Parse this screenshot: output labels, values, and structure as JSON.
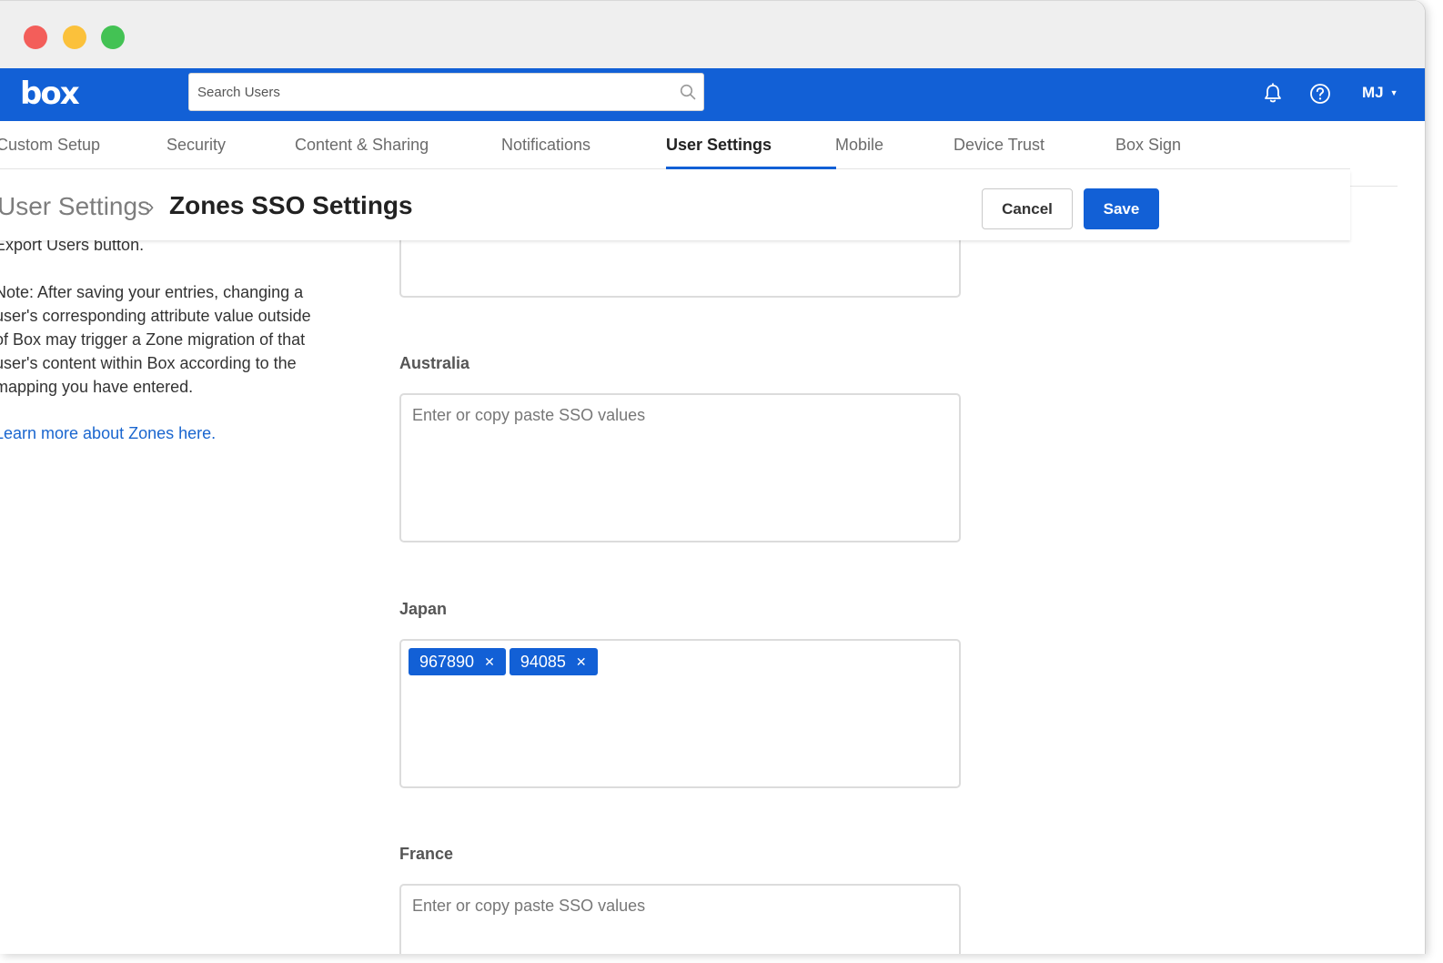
{
  "app": {
    "logo_text": "box",
    "search": {
      "placeholder": "Search Users",
      "value": ""
    },
    "user_initials": "MJ",
    "accent_color": "#1260d6"
  },
  "tabs": [
    {
      "label": "Custom Setup"
    },
    {
      "label": "Security"
    },
    {
      "label": "Content & Sharing"
    },
    {
      "label": "Notifications"
    },
    {
      "label": "User Settings",
      "active": true
    },
    {
      "label": "Mobile"
    },
    {
      "label": "Device Trust"
    },
    {
      "label": "Box Sign"
    }
  ],
  "header": {
    "breadcrumb_parent": "User Settings",
    "breadcrumb_separator": "›",
    "title": "Zones SSO Settings",
    "cancel_label": "Cancel",
    "save_label": "Save"
  },
  "sidebar": {
    "lines_top": [
      "Export Users button."
    ],
    "note_lines": [
      "Note: After saving your entries, changing a",
      "user's corresponding attribute value outside",
      "of Box may trigger a Zone migration of that",
      "user's content within Box according to the",
      "mapping you have entered."
    ],
    "learn_more": "Learn more about Zones here."
  },
  "fields": [
    {
      "label": "Australia",
      "placeholder": "Enter or copy paste SSO values",
      "values": []
    },
    {
      "label": "Japan",
      "placeholder": "",
      "values": [
        "967890",
        "94085"
      ]
    },
    {
      "label": "France",
      "placeholder": "Enter or copy paste SSO values",
      "values": []
    }
  ]
}
